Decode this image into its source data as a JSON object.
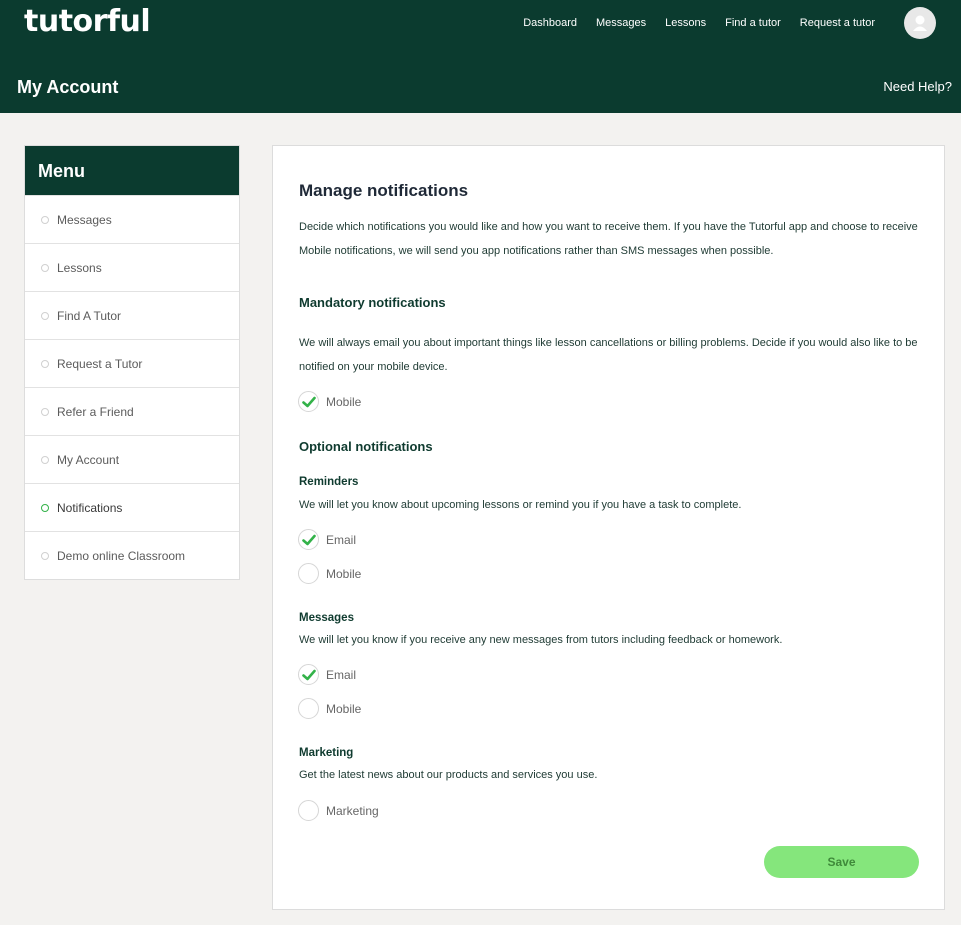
{
  "header": {
    "logo": "tutorful",
    "nav": [
      "Dashboard",
      "Messages",
      "Lessons",
      "Find a tutor",
      "Request a tutor"
    ],
    "page_title": "My Account",
    "help_link": "Need Help?"
  },
  "sidebar": {
    "title": "Menu",
    "items": [
      {
        "label": "Messages"
      },
      {
        "label": "Lessons"
      },
      {
        "label": "Find A Tutor"
      },
      {
        "label": "Request a Tutor"
      },
      {
        "label": "Refer a Friend"
      },
      {
        "label": "My Account"
      },
      {
        "label": "Notifications",
        "active": true
      },
      {
        "label": "Demo online Classroom"
      }
    ]
  },
  "main": {
    "title": "Manage notifications",
    "intro": "Decide which notifications you would like and how you want to receive them. If you have the Tutorful app and choose to receive Mobile notifications, we will send you app notifications rather than SMS messages when possible.",
    "mandatory": {
      "heading": "Mandatory notifications",
      "description": "We will always email you about important things like lesson cancellations or billing problems. Decide if you would also like to be notified on your mobile device.",
      "options": [
        {
          "label": "Mobile",
          "checked": true
        }
      ]
    },
    "optional_heading": "Optional notifications",
    "reminders": {
      "heading": "Reminders",
      "description": "We will let you know about upcoming lessons or remind you if you have a task to complete.",
      "options": [
        {
          "label": "Email",
          "checked": true
        },
        {
          "label": "Mobile",
          "checked": false
        }
      ]
    },
    "messages": {
      "heading": "Messages",
      "description": "We will let you know if you receive any new messages from tutors including feedback or homework.",
      "options": [
        {
          "label": "Email",
          "checked": true
        },
        {
          "label": "Mobile",
          "checked": false
        }
      ]
    },
    "marketing": {
      "heading": "Marketing",
      "description": "Get the latest news about our products and services you use.",
      "options": [
        {
          "label": "Marketing",
          "checked": false
        }
      ]
    },
    "save_label": "Save"
  },
  "colors": {
    "brand": "#0b3b2f",
    "check": "#33b249",
    "save_button": "#85e67c"
  }
}
